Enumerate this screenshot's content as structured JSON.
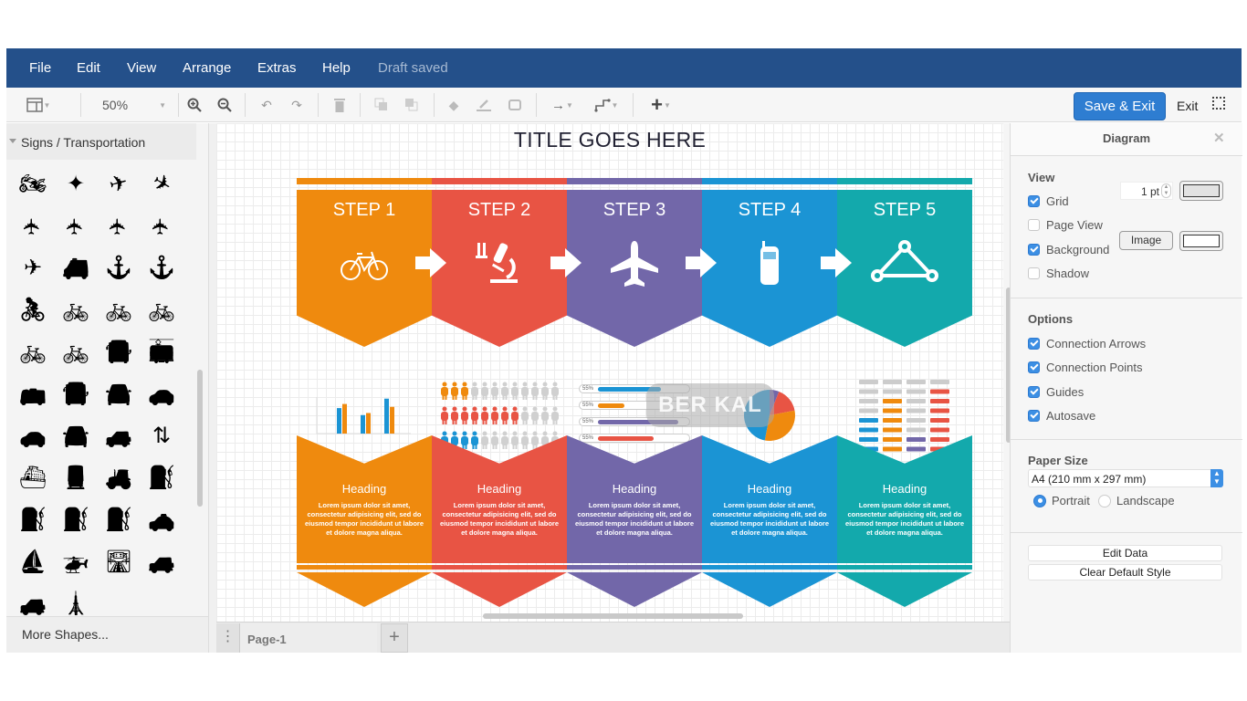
{
  "menubar": {
    "items": [
      "File",
      "Edit",
      "View",
      "Arrange",
      "Extras",
      "Help"
    ],
    "status": "Draft saved",
    "color": "#24508a"
  },
  "toolbar": {
    "zoom": "50%",
    "save_exit_label": "Save & Exit",
    "exit_label": "Exit",
    "icons": [
      "format-panel-icon",
      "zoom-in-icon",
      "zoom-out-icon",
      "undo-icon",
      "redo-icon",
      "delete-icon",
      "to-front-icon",
      "to-back-icon",
      "fill-color-icon",
      "line-color-icon",
      "shadow-icon",
      "connection-icon",
      "waypoints-icon",
      "insert-icon",
      "fullscreen-icon"
    ]
  },
  "left_panel": {
    "section_title": "Signs / Transportation",
    "more_shapes": "More Shapes...",
    "shapes": [
      "atv",
      "airbag",
      "plane-takeoff",
      "plane-landing",
      "plane",
      "plane",
      "plane",
      "plane",
      "plane-side",
      "ambulance",
      "anchor",
      "anchor",
      "cyclist",
      "bicycle",
      "bicycle",
      "bicycle",
      "bicycle",
      "bicycle",
      "bus-front",
      "tram",
      "bus-side",
      "bus-front",
      "car-front",
      "car-side",
      "car-side",
      "car-front",
      "car-rental",
      "road-split",
      "ferry",
      "train",
      "forklift",
      "fuel-pump",
      "fuel-pump",
      "fuel-pump",
      "fuel-pump",
      "taxi-bus",
      "boat-crane",
      "helicopter",
      "highway",
      "jeep",
      "jeep",
      "lighthouse"
    ]
  },
  "page_tabs": {
    "tabs": [
      "Page-1"
    ],
    "add_label": "+"
  },
  "diagram": {
    "title": "TITLE GOES HERE",
    "watermark": "BER KAL",
    "steps": [
      {
        "label": "STEP 1",
        "icon": "bicycle-icon",
        "color": "#ef8a0e",
        "heading": "Heading"
      },
      {
        "label": "STEP 2",
        "icon": "microscope-icon",
        "color": "#e85444",
        "heading": "Heading"
      },
      {
        "label": "STEP 3",
        "icon": "airplane-icon",
        "color": "#7267a9",
        "heading": "Heading"
      },
      {
        "label": "STEP 4",
        "icon": "mobile-phone-icon",
        "color": "#1b94d4",
        "heading": "Heading"
      },
      {
        "label": "STEP 5",
        "icon": "network-triangle-icon",
        "color": "#13a9ac",
        "heading": "Heading"
      }
    ],
    "lorem": "Lorem ipsum dolor sit amet, consectetur adipisicing elit, sed do eiusmod tempor incididunt ut labore et dolore magna aliqua.",
    "bar_chart": {
      "groups": [
        [
          0.62,
          0.72
        ],
        [
          0.45,
          0.5
        ],
        [
          0.85,
          0.65
        ]
      ]
    },
    "people_rows": [
      {
        "filled": 3,
        "total": 12,
        "color": "#ef8a0e"
      },
      {
        "filled": 8,
        "total": 12,
        "color": "#e85444"
      },
      {
        "filled": 4,
        "total": 12,
        "color": "#1b94d4"
      }
    ],
    "progress_bars": [
      {
        "label": "55%",
        "value": 0.7,
        "color": "#1b94d4"
      },
      {
        "label": "55%",
        "value": 0.3,
        "color": "#ef8a0e"
      },
      {
        "label": "55%",
        "value": 0.9,
        "color": "#7267a9"
      },
      {
        "label": "55%",
        "value": 0.62,
        "color": "#e85444"
      }
    ],
    "pie": [
      {
        "value": 0.47,
        "color": "#1b94d4"
      },
      {
        "value": 0.31,
        "color": "#ef8a0e"
      },
      {
        "value": 0.16,
        "color": "#e85444"
      },
      {
        "value": 0.06,
        "color": "#7267a9"
      }
    ],
    "bar_table": {
      "rows": [
        [
          "#cccccc",
          "#cccccc",
          "#cccccc",
          "#cccccc"
        ],
        [
          "#cccccc",
          "#cccccc",
          "#cccccc",
          "#e85444"
        ],
        [
          "#cccccc",
          "#ef8a0e",
          "#cccccc",
          "#e85444"
        ],
        [
          "#cccccc",
          "#ef8a0e",
          "#cccccc",
          "#e85444"
        ],
        [
          "#1b94d4",
          "#ef8a0e",
          "#cccccc",
          "#e85444"
        ],
        [
          "#1b94d4",
          "#ef8a0e",
          "#cccccc",
          "#e85444"
        ],
        [
          "#1b94d4",
          "#ef8a0e",
          "#7267a9",
          "#e85444"
        ],
        [
          "#1b94d4",
          "#ef8a0e",
          "#7267a9",
          "#e85444"
        ]
      ]
    }
  },
  "right_panel": {
    "title": "Diagram",
    "view": {
      "title": "View",
      "grid": {
        "label": "Grid",
        "checked": true,
        "size": "1 pt"
      },
      "page_view": {
        "label": "Page View",
        "checked": false
      },
      "background": {
        "label": "Background",
        "checked": true,
        "image_label": "Image"
      },
      "shadow": {
        "label": "Shadow",
        "checked": false
      }
    },
    "options": {
      "title": "Options",
      "items": [
        {
          "label": "Connection Arrows",
          "checked": true
        },
        {
          "label": "Connection Points",
          "checked": true
        },
        {
          "label": "Guides",
          "checked": true
        },
        {
          "label": "Autosave",
          "checked": true
        }
      ]
    },
    "paper": {
      "title": "Paper Size",
      "selected": "A4 (210 mm x 297 mm)",
      "portrait": "Portrait",
      "landscape": "Landscape",
      "orientation": "portrait"
    },
    "buttons": {
      "edit_data": "Edit Data",
      "clear_style": "Clear Default Style"
    }
  }
}
